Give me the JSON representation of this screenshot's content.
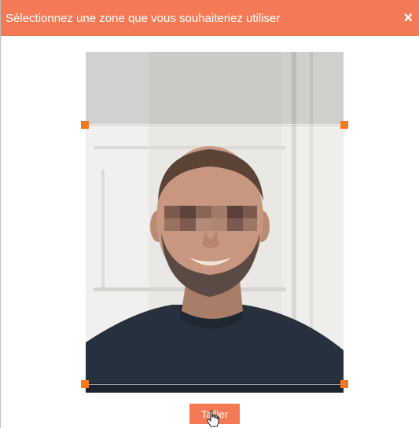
{
  "dialog": {
    "title": "Sélectionnez une zone que vous souhaiteriez utiliser",
    "close_glyph": "×",
    "crop_button_label": "Tailler"
  },
  "icons": {
    "close": "close-icon",
    "cursor": "hand-pointer-icon"
  },
  "colors": {
    "accent": "#f47a56",
    "handle": "#f47a1f"
  }
}
